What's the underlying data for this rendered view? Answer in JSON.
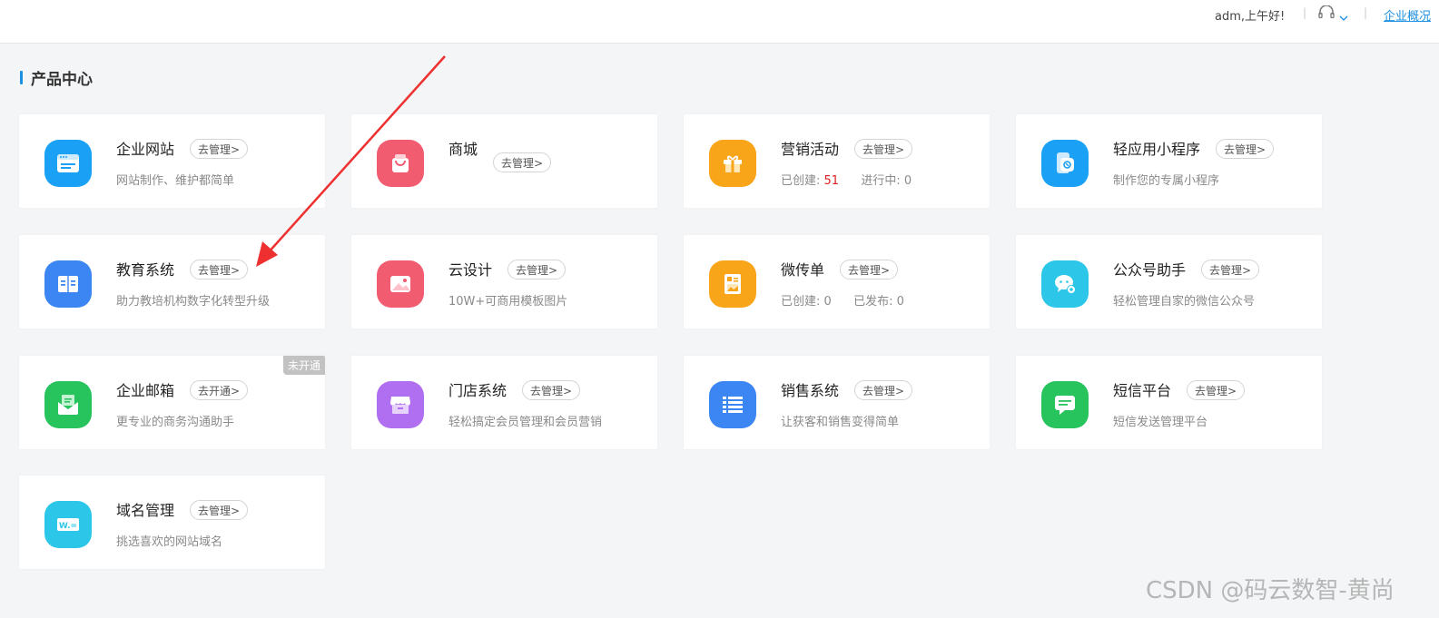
{
  "header": {
    "greeting": "adm,上午好!",
    "separator": "|",
    "overview_link": "企业概况"
  },
  "section": {
    "title": "产品中心"
  },
  "cards": [
    {
      "name": "企业网站",
      "action": "去管理>",
      "desc": "网站制作、维护都简单",
      "icon": "website-icon",
      "color": "#1aa0f5"
    },
    {
      "name": "商城",
      "action": "去管理>",
      "desc": "",
      "icon": "shopping-bag-icon",
      "color": "#f25c70"
    },
    {
      "name": "营销活动",
      "action": "去管理>",
      "stats": {
        "label1": "已创建:",
        "value1": "51",
        "label2": "进行中:",
        "value2": "0"
      },
      "icon": "gift-icon",
      "color": "#f8a51a"
    },
    {
      "name": "轻应用小程序",
      "action": "去管理>",
      "desc": "制作您的专属小程序",
      "icon": "mini-program-icon",
      "color": "#1aa0f5"
    },
    {
      "name": "教育系统",
      "action": "去管理>",
      "desc": "助力教培机构数字化转型升级",
      "icon": "book-icon",
      "color": "#3b86f2"
    },
    {
      "name": "云设计",
      "action": "去管理>",
      "desc": "10W+可商用模板图片",
      "icon": "image-icon",
      "color": "#f25c70"
    },
    {
      "name": "微传单",
      "action": "去管理>",
      "stats": {
        "label1": "已创建:",
        "value1": "0",
        "label2": "已发布:",
        "value2": "0"
      },
      "icon": "flyer-icon",
      "color": "#f8a51a"
    },
    {
      "name": "公众号助手",
      "action": "去管理>",
      "desc": "轻松管理自家的微信公众号",
      "icon": "wechat-icon",
      "color": "#2cc7e8"
    },
    {
      "name": "企业邮箱",
      "action": "去开通>",
      "desc": "更专业的商务沟通助手",
      "icon": "mail-icon",
      "color": "#27c35c",
      "badge": "未开通"
    },
    {
      "name": "门店系统",
      "action": "去管理>",
      "desc": "轻松搞定会员管理和会员营销",
      "icon": "store-icon",
      "color": "#b06ef0"
    },
    {
      "name": "销售系统",
      "action": "去管理>",
      "desc": "让获客和销售变得简单",
      "icon": "list-icon",
      "color": "#3b86f2"
    },
    {
      "name": "短信平台",
      "action": "去管理>",
      "desc": "短信发送管理平台",
      "icon": "sms-icon",
      "color": "#27c35c"
    },
    {
      "name": "域名管理",
      "action": "去管理>",
      "desc": "挑选喜欢的网站域名",
      "icon": "domain-icon",
      "color": "#2cc7e8",
      "icon_text": "W.="
    }
  ],
  "watermark": "CSDN @码云数智-黄尚",
  "colors": {
    "accent": "#1d8fe1",
    "arrow": "#ee3030",
    "red_number": "#e02020"
  }
}
